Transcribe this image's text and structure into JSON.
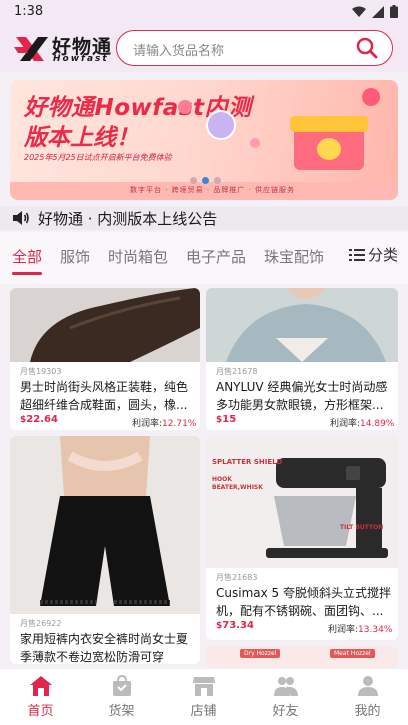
{
  "status_bar": {
    "time": "1:38"
  },
  "header": {
    "logo_cn": "好物通",
    "logo_en": "Howfast",
    "search_placeholder": "请输入货品名称"
  },
  "banner": {
    "title_line1": "好物通Howfast内测",
    "title_line2": "版本上线！",
    "subtitle": "2025年5月25日试点开启新平台免费体验",
    "strip_text": "数字平台 · 跨境贸易 · 品牌推广 · 供应链服务"
  },
  "notice": {
    "text": "好物通 · 内测版本上线公告"
  },
  "tabs": {
    "items": [
      "全部",
      "服饰",
      "时尚箱包",
      "电子产品",
      "珠宝配饰"
    ],
    "category_label": "分类"
  },
  "products": [
    {
      "sold": "月售19303",
      "title": "男士时尚街头风格正装鞋，纯色超细纤维合成鞋面，圆头，橡...",
      "currency": "$",
      "price": "22.64",
      "rate_label": "利润率:",
      "rate": "12.71%"
    },
    {
      "sold": "月售21678",
      "title": "ANYLUV 经典偏光女士时尚动感多功能男女款眼镜，方形框架...",
      "currency": "$",
      "price": "15",
      "rate_label": "利润率:",
      "rate": "14.89%"
    },
    {
      "sold": "月售26922",
      "title": "家用短裤内衣安全裤时尚女士夏季薄款不卷边宽松防滑可穿",
      "currency": "$",
      "price": "",
      "rate_label": "",
      "rate": ""
    },
    {
      "sold": "月售21683",
      "title": "Cusimax 5 夸脱倾斜头立式搅拌机，配有不锈钢碗、面团钩、...",
      "currency": "$",
      "price": "73.34",
      "rate_label": "利润率:",
      "rate": "13.34%"
    }
  ],
  "product_image_labels": {
    "mixer_top": "SPLATTER SHIELD",
    "mixer_hook": "HOOK BEATER,WHISK",
    "mixer_tilt": "TILT BUTTON",
    "next_1": "Dry Hozzel",
    "next_2": "Meat Hozzel"
  },
  "nav": {
    "items": [
      {
        "label": "首页",
        "icon": "home-icon"
      },
      {
        "label": "货架",
        "icon": "bag-icon"
      },
      {
        "label": "店铺",
        "icon": "shop-icon"
      },
      {
        "label": "好友",
        "icon": "friends-icon"
      },
      {
        "label": "我的",
        "icon": "profile-icon"
      }
    ]
  },
  "colors": {
    "accent": "#e0264a",
    "background": "#f4f0f5"
  }
}
